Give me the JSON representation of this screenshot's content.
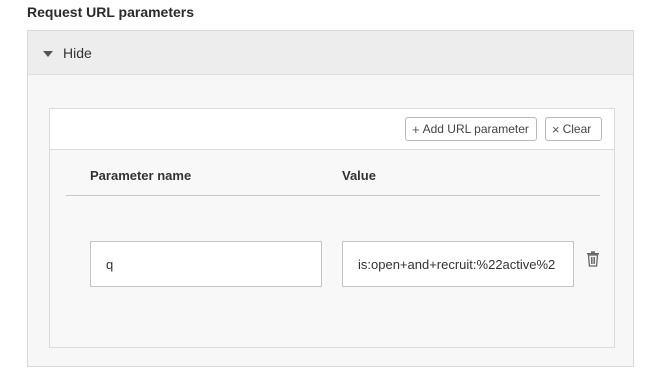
{
  "section": {
    "title": "Request URL parameters"
  },
  "panel": {
    "toggle_label": "Hide",
    "toggle_icon": "caret-down-icon"
  },
  "toolbar": {
    "add_label": "Add URL parameter",
    "add_icon": "plus-icon",
    "clear_label": "Clear",
    "clear_icon": "close-icon"
  },
  "table": {
    "columns": [
      "Parameter name",
      "Value"
    ],
    "rows": [
      {
        "name": "q",
        "value": "is:open+and+recruit:%22active%2",
        "delete_icon": "trash-icon"
      }
    ]
  },
  "colors": {
    "panel_header_bg": "#ededed",
    "panel_body_bg": "#f7f7f7",
    "border": "#d9d9d9",
    "text": "#2b2b2b"
  }
}
